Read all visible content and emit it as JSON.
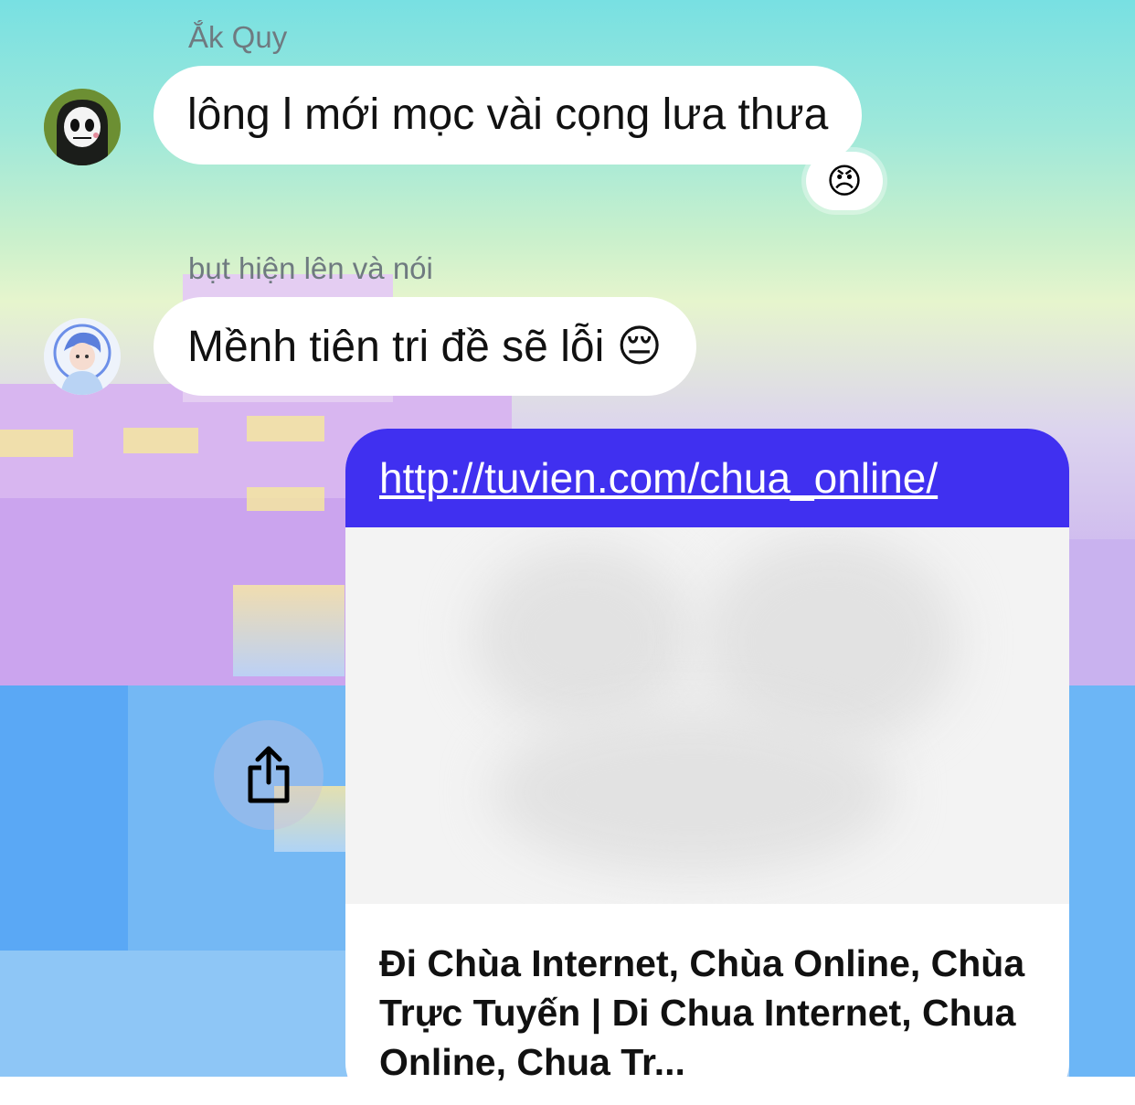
{
  "messages": [
    {
      "sender": "Ắk Quy",
      "text": "lông l mới mọc vài cọng lưa thưa",
      "reaction": "😠"
    },
    {
      "sender": "bụt hiện lên và nói",
      "text": "Mềnh tiên tri đề sẽ lỗi 😔"
    }
  ],
  "link_preview": {
    "url": "http://tuvien.com/chua_online/",
    "title": "Đi Chùa Internet, Chùa Online, Chùa Trực Tuyến | Di Chua Internet, Chua Online, Chua Tr..."
  },
  "colors": {
    "link_header": "#4030f0",
    "bubble": "#ffffff",
    "sender_text": "#6f7a80"
  },
  "icons": {
    "share": "share-icon",
    "avatar1": "skull-avatar",
    "avatar2": "anime-avatar"
  }
}
